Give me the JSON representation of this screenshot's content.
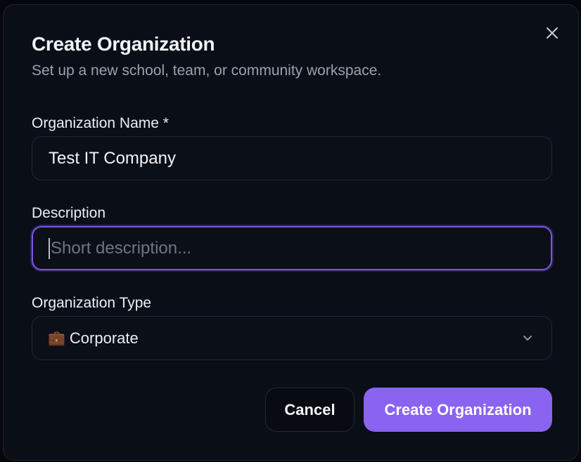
{
  "dialog": {
    "title": "Create Organization",
    "subtitle": "Set up a new school, team, or community workspace."
  },
  "fields": {
    "name": {
      "label": "Organization Name *",
      "value": "Test IT Company"
    },
    "description": {
      "label": "Description",
      "value": "",
      "placeholder": "Short description..."
    },
    "type": {
      "label": "Organization Type",
      "icon": "💼",
      "selected": "Corporate"
    }
  },
  "actions": {
    "cancel_label": "Cancel",
    "create_label": "Create Organization"
  },
  "colors": {
    "accent": "#8a63f0",
    "focus_ring": "#7b56de",
    "background": "#0a0e17"
  },
  "icons": {
    "close": "close-icon",
    "dropdown": "chevron-down-icon",
    "type": "briefcase-icon"
  }
}
